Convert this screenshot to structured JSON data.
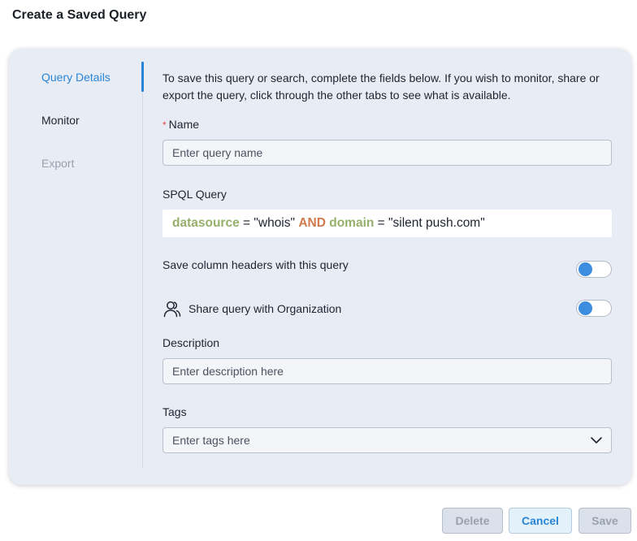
{
  "dialog": {
    "title": "Create a Saved Query"
  },
  "tabs": [
    {
      "label": "Query Details",
      "state": "active"
    },
    {
      "label": "Monitor",
      "state": "normal"
    },
    {
      "label": "Export",
      "state": "disabled"
    }
  ],
  "form": {
    "intro": "To save this query or search, complete the fields below. If you wish to monitor, share or export the query, click through the other tabs to see what is available.",
    "name": {
      "required_marker": "*",
      "label": "Name",
      "placeholder": "Enter query name"
    },
    "spql": {
      "label": "SPQL Query",
      "field1": "datasource",
      "eq1": " = ",
      "value1": "\"whois\"",
      "operator": "AND",
      "field2": "domain",
      "eq2": " = ",
      "value2": "\"silent push.com\""
    },
    "save_headers": {
      "label": "Save column headers with this query",
      "on": false
    },
    "share": {
      "label": "Share query with Organization",
      "icon": "users-icon",
      "on": false
    },
    "description": {
      "label": "Description",
      "placeholder": "Enter description here"
    },
    "tags": {
      "label": "Tags",
      "placeholder": "Enter tags here",
      "icon": "chevron-down-icon"
    }
  },
  "buttons": {
    "delete": "Delete",
    "cancel": "Cancel",
    "save": "Save"
  },
  "colors": {
    "accent": "#2a85d6",
    "toggle_knob": "#3c8de0",
    "spql_field": "#94b06b",
    "spql_operator": "#d17a4d",
    "required": "#e04848"
  }
}
